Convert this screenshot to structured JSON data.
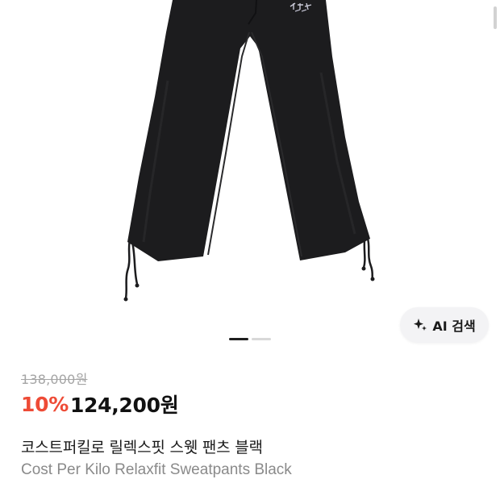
{
  "product_image": {
    "alt": "black relaxfit sweatpants with drawstring hems"
  },
  "ai_search": {
    "label": "AI 검색",
    "icon": "sparkle-icon"
  },
  "carousel": {
    "count": 2,
    "active_index": 0
  },
  "pricing": {
    "original_price": "138,000원",
    "discount": "10%",
    "sale_price": "124,200원",
    "discount_color": "#ee4b36"
  },
  "product": {
    "name_ko": "코스트퍼킬로 릴렉스핏 스웻 팬츠 블랙",
    "name_en": "Cost Per Kilo Relaxfit Sweatpants Black"
  }
}
